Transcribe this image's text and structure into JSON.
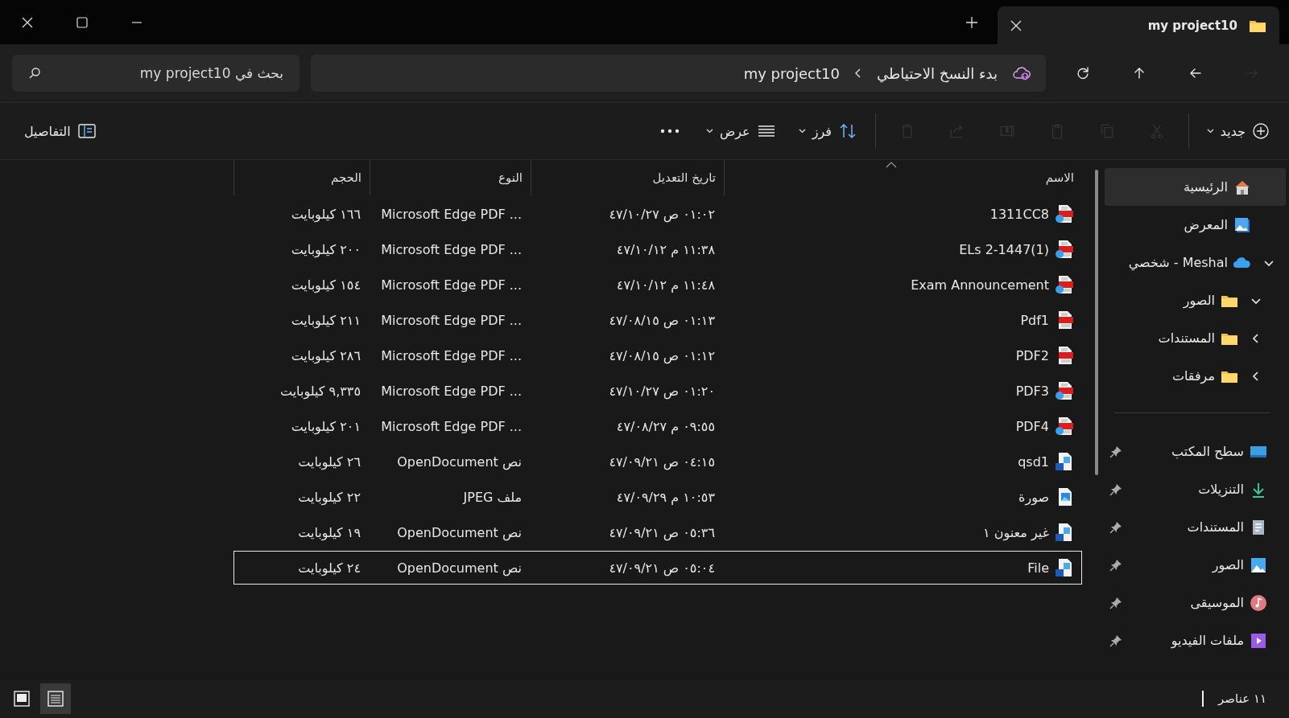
{
  "tab": {
    "title": "my project10",
    "selected": true
  },
  "nav": [
    {
      "kind": "forward",
      "disabled": true
    },
    {
      "kind": "back",
      "disabled": false
    },
    {
      "kind": "up",
      "disabled": false
    },
    {
      "kind": "refresh",
      "disabled": false
    }
  ],
  "address": {
    "crumbs": [
      "بدء النسخ الاحتياطي",
      "my project10"
    ]
  },
  "search": {
    "placeholder": "بحث في my project10"
  },
  "toolbar": [
    {
      "kind": "new",
      "label": "جديد",
      "disabled": false
    },
    {
      "kind": "cut",
      "disabled": true
    },
    {
      "kind": "copy",
      "disabled": true
    },
    {
      "kind": "paste",
      "disabled": true
    },
    {
      "kind": "rename",
      "disabled": true
    },
    {
      "kind": "share",
      "disabled": true
    },
    {
      "kind": "delete",
      "disabled": true
    },
    {
      "kind": "sort",
      "label": "فرز",
      "disabled": false
    },
    {
      "kind": "view",
      "label": "عرض",
      "disabled": false
    },
    {
      "kind": "more",
      "disabled": false
    }
  ],
  "details_button": {
    "label": "التفاصيل"
  },
  "sidebar": {
    "items": [
      {
        "label": "الرئيسية",
        "kind": "home",
        "selected": true
      },
      {
        "label": "المعرض",
        "kind": "gallery",
        "selected": false
      },
      {
        "label": "Meshal - شخصي",
        "kind": "cloud",
        "selected": false,
        "expanded": true,
        "children": [
          {
            "label": "الصور",
            "selected": false,
            "expanded": true
          },
          {
            "label": "المستندات",
            "selected": false,
            "expanded": false
          },
          {
            "label": "مرفقات",
            "selected": false,
            "expanded": false
          }
        ]
      }
    ],
    "pinned": [
      {
        "label": "سطح المكتب",
        "kind": "desktop",
        "selected": false
      },
      {
        "label": "التنزيلات",
        "kind": "download",
        "selected": false
      },
      {
        "label": "المستندات",
        "kind": "documents",
        "selected": false
      },
      {
        "label": "الصور",
        "kind": "pictures",
        "selected": false
      },
      {
        "label": "الموسيقى",
        "kind": "music",
        "selected": false
      },
      {
        "label": "ملفات الفيديو",
        "kind": "videos",
        "selected": false
      }
    ]
  },
  "table": {
    "columns": [
      {
        "label": "الاسم",
        "sorted": true
      },
      {
        "label": "تاريخ التعديل",
        "sorted": false
      },
      {
        "label": "النوع",
        "sorted": false
      },
      {
        "label": "الحجم",
        "sorted": false
      }
    ],
    "rows": [
      {
        "kind": "pdf-edge",
        "name": "1311CC8",
        "date": "٠١:٠٢ ص ٤٧/١٠/٢٧",
        "type": "Microsoft Edge PDF ...",
        "size": "١٦٦ كيلوبايت",
        "selected": false
      },
      {
        "kind": "pdf-edge",
        "name": "ELs 2-1447(1)",
        "date": "١١:٣٨ م ٤٧/١٠/١٢",
        "type": "Microsoft Edge PDF ...",
        "size": "٢٠٠ كيلوبايت",
        "selected": false
      },
      {
        "kind": "pdf-edge",
        "name": "Exam Announcement",
        "date": "١١:٤٨ م ٤٧/١٠/١٢",
        "type": "Microsoft Edge PDF ...",
        "size": "١٥٤ كيلوبايت",
        "selected": false
      },
      {
        "kind": "pdf",
        "name": "Pdf1",
        "date": "٠١:١٣ ص ٤٧/٠٨/١٥",
        "type": "Microsoft Edge PDF ...",
        "size": "٢١١ كيلوبايت",
        "selected": false
      },
      {
        "kind": "pdf",
        "name": "PDF2",
        "date": "٠١:١٢ ص ٤٧/٠٨/١٥",
        "type": "Microsoft Edge PDF ...",
        "size": "٢٨٦ كيلوبايت",
        "selected": false
      },
      {
        "kind": "pdf-edge",
        "name": "PDF3",
        "date": "٠١:٢٠ ص ٤٧/١٠/٢٧",
        "type": "Microsoft Edge PDF ...",
        "size": "٩,٣٣٥ كيلوبايت",
        "selected": false
      },
      {
        "kind": "pdf-edge",
        "name": "PDF4",
        "date": "٠٩:٥٥ م ٤٧/٠٨/٢٧",
        "type": "Microsoft Edge PDF ...",
        "size": "٢٠١ كيلوبايت",
        "selected": false
      },
      {
        "kind": "word",
        "name": "qsd1",
        "date": "٠٤:١٥ ص ٤٧/٠٩/٢١",
        "type": "OpenDocument نص",
        "size": "٢٦ كيلوبايت",
        "selected": false
      },
      {
        "kind": "image",
        "name": "صورة",
        "date": "١٠:٥٣ م ٤٧/٠٩/٢٩",
        "type": "ملف JPEG",
        "size": "٢٢ كيلوبايت",
        "selected": false
      },
      {
        "kind": "word",
        "name": "غير معنون ١",
        "date": "٠٥:٣٦ ص ٤٧/٠٩/٢١",
        "type": "OpenDocument نص",
        "size": "١٩ كيلوبايت",
        "selected": false
      },
      {
        "kind": "word",
        "name": "File",
        "date": "٠٥:٠٤ ص ٤٧/٠٩/٢١",
        "type": "OpenDocument نص",
        "size": "٢٤ كيلوبايت",
        "selected": true
      }
    ]
  },
  "status_bar": {
    "count": "١١ عناصر",
    "view_modes": [
      {
        "kind": "details",
        "selected": true
      },
      {
        "kind": "tiles",
        "selected": false
      }
    ]
  }
}
